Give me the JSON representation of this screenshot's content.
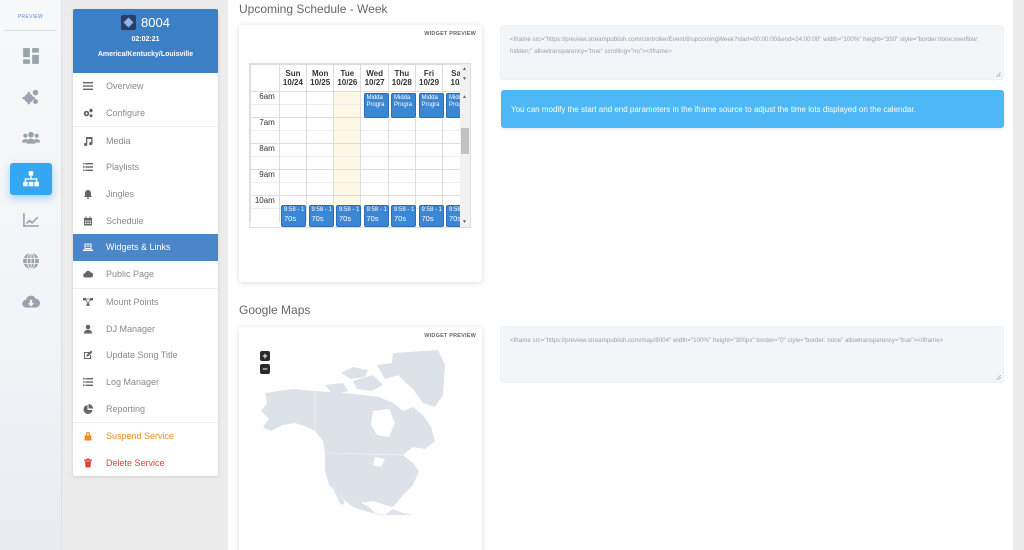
{
  "rail": {
    "brand": "PREVIEW",
    "icons": [
      {
        "name": "dashboard-icon",
        "active": false
      },
      {
        "name": "cogs-icon",
        "active": false
      },
      {
        "name": "users-icon",
        "active": false
      },
      {
        "name": "sitemap-icon",
        "active": true
      },
      {
        "name": "chart-line-icon",
        "active": false
      },
      {
        "name": "globe-icon",
        "active": false
      },
      {
        "name": "cloud-download-icon",
        "active": false
      }
    ]
  },
  "service": {
    "id": "8004",
    "time": "02:02:21",
    "timezone": "America/Kentucky/Louisville",
    "menu": [
      {
        "label": "Overview",
        "icon": "list-icon",
        "group": 1
      },
      {
        "label": "Configure",
        "icon": "cogs-icon",
        "group": 1
      },
      {
        "label": "Media",
        "icon": "music-icon",
        "group": 2
      },
      {
        "label": "Playlists",
        "icon": "list-ul-icon",
        "group": 2
      },
      {
        "label": "Jingles",
        "icon": "bell-icon",
        "group": 2
      },
      {
        "label": "Schedule",
        "icon": "calendar-icon",
        "group": 2
      },
      {
        "label": "Widgets & Links",
        "icon": "laptop-icon",
        "group": 2,
        "active": true
      },
      {
        "label": "Public Page",
        "icon": "cloud-icon",
        "group": 2
      },
      {
        "label": "Mount Points",
        "icon": "sitemap-icon",
        "group": 3
      },
      {
        "label": "DJ Manager",
        "icon": "user-icon",
        "group": 3
      },
      {
        "label": "Update Song Title",
        "icon": "edit-icon",
        "group": 3
      },
      {
        "label": "Log Manager",
        "icon": "list-ul-icon",
        "group": 3
      },
      {
        "label": "Reporting",
        "icon": "pie-chart-icon",
        "group": 3
      },
      {
        "label": "Suspend Service",
        "icon": "lock-icon",
        "group": 4,
        "variant": "warn"
      },
      {
        "label": "Delete Service",
        "icon": "trash-icon",
        "group": 4,
        "variant": "danger"
      }
    ]
  },
  "schedule_section": {
    "title": "Upcoming Schedule - Week",
    "widget_label": "WIDGET PREVIEW",
    "calendar": {
      "days": [
        {
          "dow": "Sun",
          "date": "10/24"
        },
        {
          "dow": "Mon",
          "date": "10/25"
        },
        {
          "dow": "Tue",
          "date": "10/26",
          "today": true
        },
        {
          "dow": "Wed",
          "date": "10/27"
        },
        {
          "dow": "Thu",
          "date": "10/28"
        },
        {
          "dow": "Fri",
          "date": "10/29"
        },
        {
          "dow": "Sa",
          "date": "10/"
        }
      ],
      "hours": [
        "6am",
        "7am",
        "8am",
        "9am",
        "10am"
      ],
      "events_6am": {
        "line1": "Midda",
        "line2": "Progra",
        "days": [
          3,
          4,
          5,
          6
        ]
      },
      "events_10am": {
        "line1": "9:58 - 1",
        "line2": "70s",
        "days": [
          0,
          1,
          2,
          3,
          4,
          5,
          6
        ]
      }
    },
    "embed_code": "<iframe src=\"https://preview.streampublish.com/controller/Event/8/upcomingWeek?start=00:00:00&end=24:00:00\" width=\"100%\" height=\"350\" style=\"border:none;overflow: hidden;\" allowtransparency=\"true\" scrolling=\"no\"></iframe>",
    "info": "You can modify the start and end parameters in the iframe source to adjust the time lots displayed on the calendar."
  },
  "maps_section": {
    "title": "Google Maps",
    "widget_label": "WIDGET PREVIEW",
    "zoom_in": "+",
    "zoom_out": "−",
    "embed_code": "<iframe src=\"https://preview.streampublish.com/map/8004\" width=\"100%\" height=\"300px\" border=\"0\" style=\"border: none\" allowtransparency=\"true\"></iframe>"
  },
  "colors": {
    "accent": "#34a6f2",
    "header_blue": "#3d7fc4",
    "event_blue": "#3a87d6",
    "info_blue": "#4db8f5",
    "warn": "#f08a24",
    "danger": "#e0413a"
  }
}
